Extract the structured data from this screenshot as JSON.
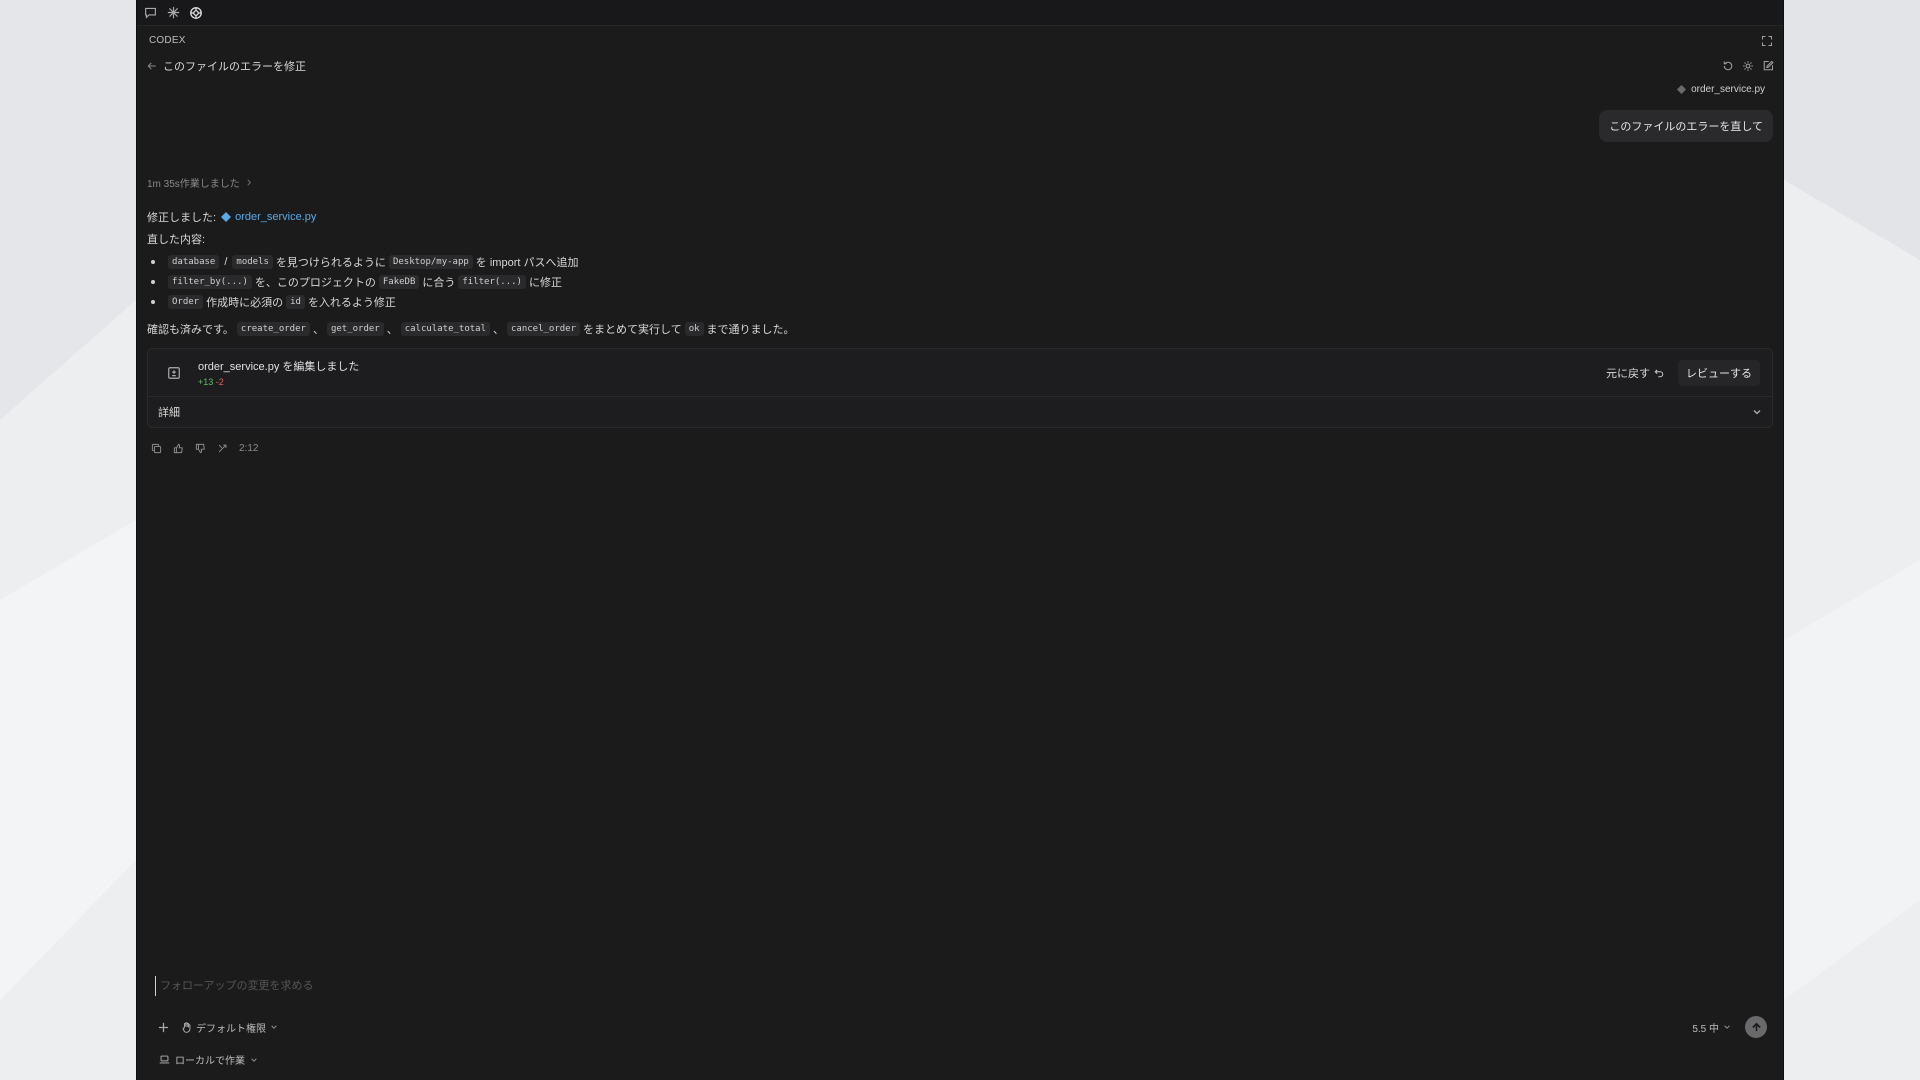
{
  "app": {
    "section_label": "CODEX",
    "thread_title": "このファイルのエラーを修正"
  },
  "icons": {
    "top_tabs": [
      "chat-bubble-icon",
      "sparkle-icon",
      "openai-knot-icon"
    ],
    "header_actions": [
      "history-icon",
      "settings-icon",
      "new-chat-icon"
    ],
    "message_actions": [
      "copy-icon",
      "thumbs-up-icon",
      "thumbs-down-icon",
      "fork-icon"
    ]
  },
  "user_message": {
    "file_tag": "order_service.py",
    "text": "このファイルのエラーを直して"
  },
  "worked": {
    "label": "1m 35s作業しました"
  },
  "assistant": {
    "fixed_prefix": "修正しました:",
    "fixed_file": "order_service.py",
    "changes_heading": "直した内容:",
    "bullets": [
      {
        "code1": "database",
        "sep": "/",
        "code2": "models",
        "text1": "を見つけられるように",
        "code3": "Desktop/my-app",
        "text2": "を import パスへ追加"
      },
      {
        "code1": "filter_by(...)",
        "text1": "を、このプロジェクトの",
        "code2": "FakeDB",
        "text2": "に合う",
        "code3": "filter(...)",
        "text3": "に修正"
      },
      {
        "code1": "Order",
        "text1": "作成時に必須の",
        "code2": "id",
        "text2": "を入れるよう修正"
      }
    ],
    "confirm": {
      "prefix": "確認も済みです。",
      "codes": [
        "create_order",
        "get_order",
        "calculate_total",
        "cancel_order"
      ],
      "sep": "、",
      "middle": "をまとめて実行して",
      "ok": "ok",
      "suffix": "まで通りました。"
    }
  },
  "edit_card": {
    "title": "order_service.py を編集しました",
    "added": "+13",
    "removed": "-2",
    "undo_label": "元に戻す",
    "review_label": "レビューする",
    "details_label": "詳細"
  },
  "message_meta": {
    "time": "2:12"
  },
  "composer": {
    "placeholder": "フォローアップの変更を求める",
    "value": "",
    "permission_label": "デフォルト権限",
    "model_label": "5.5 中",
    "local_label": "ローカルで作業"
  }
}
